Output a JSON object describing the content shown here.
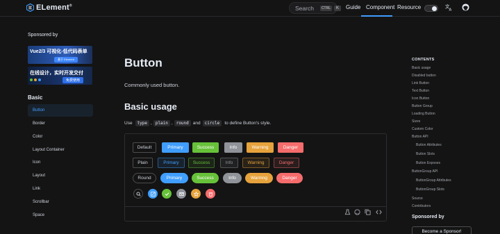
{
  "nav": {
    "logo_text": "ELement",
    "logo_sup": "®",
    "search_placeholder": "Search",
    "search_kbd_ctrl": "CTRL",
    "search_kbd_key": "K",
    "links": [
      "Guide",
      "Component",
      "Resource"
    ],
    "active_link": "Component"
  },
  "sidebar": {
    "sponsored_label": "Sponsored by",
    "banner1_text": "Vue2/3 可视化-低代码表单",
    "banner1_btn": "基于 Element",
    "banner2_text": "在线设计，实时开发交付",
    "banner2_btn": "免费使用",
    "section": "Basic",
    "items": [
      "Button",
      "Border",
      "Color",
      "Layout Container",
      "Icon",
      "Layout",
      "Link",
      "Scrollbar",
      "Space"
    ],
    "active_item": "Button"
  },
  "main": {
    "title": "Button",
    "description": "Commonly used button.",
    "subtitle": "Basic usage",
    "usage_prefix": "Use",
    "usage_codes": [
      "type",
      "plain",
      "round",
      "circle"
    ],
    "usage_seps": [
      ",",
      ",",
      "and"
    ],
    "usage_suffix": "to define Button's style.",
    "rows": [
      [
        "Default",
        "Primary",
        "Success",
        "Info",
        "Warning",
        "Danger"
      ],
      [
        "Plain",
        "Primary",
        "Success",
        "Info",
        "Warning",
        "Danger"
      ],
      [
        "Round",
        "Primary",
        "Success",
        "Info",
        "Warning",
        "Danger"
      ]
    ],
    "circle_icons": [
      "search-icon",
      "edit-icon",
      "check-icon",
      "message-icon",
      "star-icon",
      "delete-icon"
    ]
  },
  "toc": {
    "title": "CONTENTS",
    "items": [
      "Basic usage",
      "Disabled button",
      "Link Button",
      "Text Button",
      "Icon Button",
      "Button Group",
      "Loading Button",
      "Sizes",
      "Custom Color",
      "Button API",
      "Button Attributes",
      "Button Slots",
      "Button Exposes",
      "ButtonGroup API",
      "ButtonGroup Attributes",
      "ButtonGroup Slots",
      "Source",
      "Contributors"
    ],
    "sponsored_label": "Sponsored by",
    "become_sponsor": "Become a Sponsor!"
  },
  "colors": {
    "primary": "#409eff",
    "success": "#67c23a",
    "info": "#909399",
    "warning": "#e6a23c",
    "danger": "#f56c6c",
    "background": "#141414"
  }
}
